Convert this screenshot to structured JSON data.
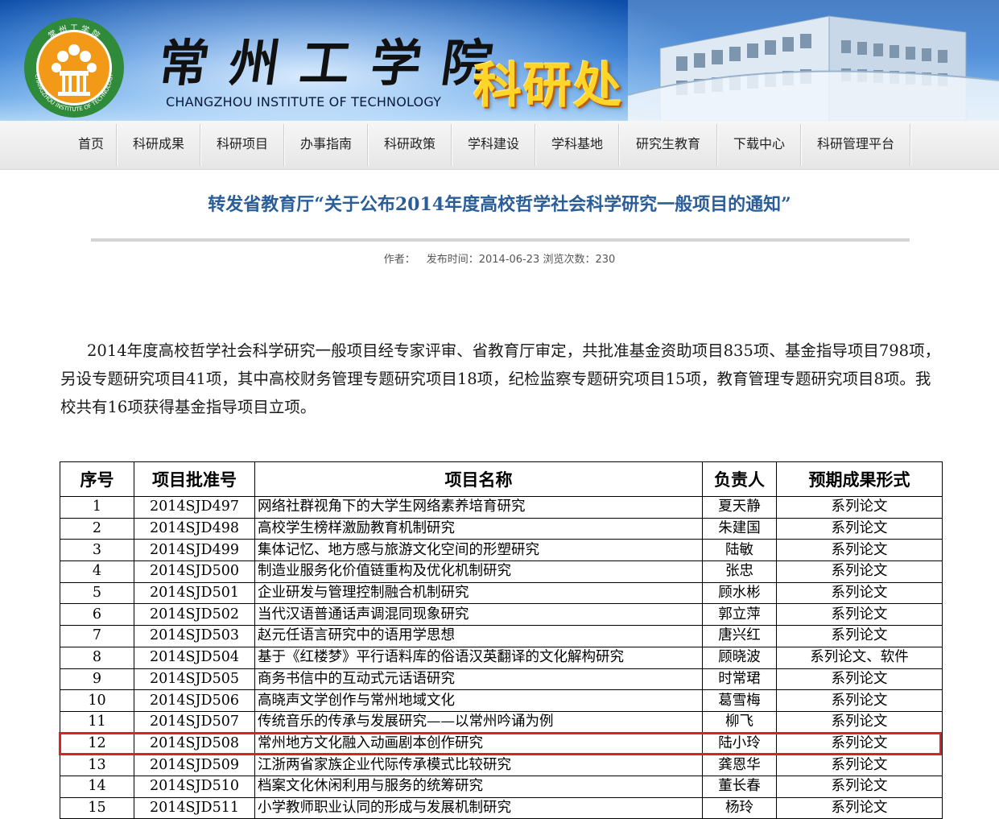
{
  "header": {
    "school_name_cn": "常州工学院",
    "school_name_en": "CHANGZHOU INSTITUTE OF TECHNOLOGY",
    "department": "科研处",
    "logo_text": "常州工学院 CHANGZHOU INSTITUTE OF TECHNOLOGY",
    "colors": {
      "banner": "#1a68c9",
      "department_text": "#ffd52a",
      "logo_orange": "#f29a18",
      "logo_green": "#2f8a3a"
    }
  },
  "nav": {
    "items": [
      "首页",
      "科研成果",
      "科研项目",
      "办事指南",
      "科研政策",
      "学科建设",
      "学科基地",
      "研究生教育",
      "下载中心",
      "科研管理平台"
    ]
  },
  "article": {
    "title": "转发省教育厅“关于公布2014年度高校哲学社会科学研究一般项目的通知”",
    "author_label": "作者：",
    "published_label": "发布时间：",
    "published_date": "2014-06-23",
    "views_label": "浏览次数：",
    "views": "230",
    "paragraph": "2014年度高校哲学社会科学研究一般项目经专家评审、省教育厅审定，共批准基金资助项目835项、基金指导项目798项，另设专题研究项目41项，其中高校财务管理专题研究项目18项，纪检监察专题研究项目15项，教育管理专题研究项目8项。我校共有16项获得基金指导项目立项。",
    "title_color": "#2b5e98",
    "highlight_color": "#d4242a"
  },
  "table": {
    "headers": [
      "序号",
      "项目批准号",
      "项目名称",
      "负责人",
      "预期成果形式"
    ],
    "rows": [
      [
        "1",
        "2014SJD497",
        "网络社群视角下的大学生网络素养培育研究",
        "夏天静",
        "系列论文"
      ],
      [
        "2",
        "2014SJD498",
        "高校学生榜样激励教育机制研究",
        "朱建国",
        "系列论文"
      ],
      [
        "3",
        "2014SJD499",
        "集体记忆、地方感与旅游文化空间的形塑研究",
        "陆敏",
        "系列论文"
      ],
      [
        "4",
        "2014SJD500",
        "制造业服务化价值链重构及优化机制研究",
        "张忠",
        "系列论文"
      ],
      [
        "5",
        "2014SJD501",
        "企业研发与管理控制融合机制研究",
        "顾水彬",
        "系列论文"
      ],
      [
        "6",
        "2014SJD502",
        "当代汉语普通话声调混同现象研究",
        "郭立萍",
        "系列论文"
      ],
      [
        "7",
        "2014SJD503",
        "赵元任语言研究中的语用学思想",
        "唐兴红",
        "系列论文"
      ],
      [
        "8",
        "2014SJD504",
        "基于《红楼梦》平行语料库的俗语汉英翻译的文化解构研究",
        "顾晓波",
        "系列论文、软件"
      ],
      [
        "9",
        "2014SJD505",
        "商务书信中的互动式元话语研究",
        "时常珺",
        "系列论文"
      ],
      [
        "10",
        "2014SJD506",
        "高晓声文学创作与常州地域文化",
        "葛雪梅",
        "系列论文"
      ],
      [
        "11",
        "2014SJD507",
        "传统音乐的传承与发展研究——以常州吟诵为例",
        "柳飞",
        "系列论文"
      ],
      [
        "12",
        "2014SJD508",
        "常州地方文化融入动画剧本创作研究",
        "陆小玲",
        "系列论文"
      ],
      [
        "13",
        "2014SJD509",
        "江浙两省家族企业代际传承模式比较研究",
        "龚恩华",
        "系列论文"
      ],
      [
        "14",
        "2014SJD510",
        "档案文化休闲利用与服务的统筹研究",
        "董长春",
        "系列论文"
      ],
      [
        "15",
        "2014SJD511",
        "小学教师职业认同的形成与发展机制研究",
        "杨玲",
        "系列论文"
      ]
    ],
    "highlighted_row": "12"
  }
}
